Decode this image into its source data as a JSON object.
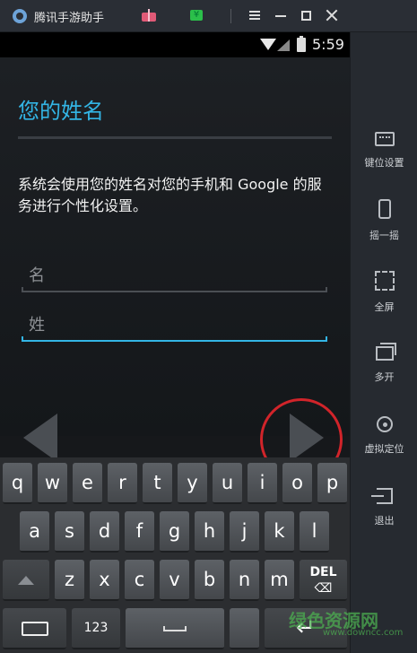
{
  "window": {
    "title": "腾讯手游助手",
    "yen_badge": "¥"
  },
  "status": {
    "time": "5:59"
  },
  "page": {
    "title": "您的姓名",
    "description": "系统会使用您的姓名对您的手机和 Google 的服务进行个性化设置。",
    "first_name_placeholder": "名",
    "last_name_placeholder": "姓"
  },
  "keyboard": {
    "row1": [
      "q",
      "w",
      "e",
      "r",
      "t",
      "y",
      "u",
      "i",
      "o",
      "p"
    ],
    "row2": [
      "a",
      "s",
      "d",
      "f",
      "g",
      "h",
      "j",
      "k",
      "l"
    ],
    "row3": [
      "z",
      "x",
      "c",
      "v",
      "b",
      "n",
      "m"
    ],
    "del_label": "DEL",
    "numeric_label": "123"
  },
  "sidebar": {
    "items": [
      {
        "label": "键位设置",
        "icon": "keyboard-icon"
      },
      {
        "label": "摇一摇",
        "icon": "shake-phone-icon"
      },
      {
        "label": "全屏",
        "icon": "fullscreen-icon"
      },
      {
        "label": "多开",
        "icon": "multi-window-icon"
      },
      {
        "label": "虚拟定位",
        "icon": "location-icon"
      },
      {
        "label": "退出",
        "icon": "exit-icon"
      }
    ]
  },
  "watermark": {
    "text": "绿色资源网",
    "sub": "www.downcc.com"
  },
  "colors": {
    "accent": "#33b5e5",
    "highlight": "#d1242a"
  }
}
